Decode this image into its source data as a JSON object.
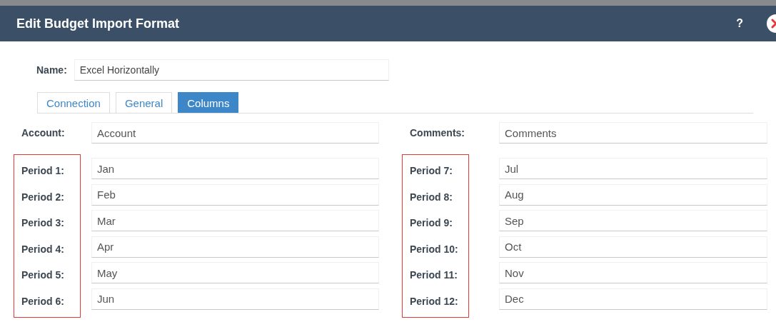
{
  "window": {
    "title": "Edit Budget Import Format",
    "help": "?"
  },
  "name_field": {
    "label": "Name:",
    "value": "Excel Horizontally"
  },
  "tabs": [
    {
      "label": "Connection",
      "selected": false
    },
    {
      "label": "General",
      "selected": false
    },
    {
      "label": "Columns",
      "selected": true
    }
  ],
  "columns": [
    {
      "header": {
        "label": "Account:",
        "value": "Account"
      },
      "periods_highlighted": true,
      "periods": [
        {
          "label": "Period 1:",
          "value": "Jan"
        },
        {
          "label": "Period 2:",
          "value": "Feb"
        },
        {
          "label": "Period 3:",
          "value": "Mar"
        },
        {
          "label": "Period 4:",
          "value": "Apr"
        },
        {
          "label": "Period 5:",
          "value": "May"
        },
        {
          "label": "Period 6:",
          "value": "Jun"
        }
      ]
    },
    {
      "header": {
        "label": "Comments:",
        "value": "Comments"
      },
      "periods_highlighted": true,
      "periods": [
        {
          "label": "Period 7:",
          "value": "Jul"
        },
        {
          "label": "Period 8:",
          "value": "Aug"
        },
        {
          "label": "Period 9:",
          "value": "Sep"
        },
        {
          "label": "Period 10:",
          "value": "Oct"
        },
        {
          "label": "Period 11:",
          "value": "Nov"
        },
        {
          "label": "Period 12:",
          "value": "Dec"
        }
      ]
    }
  ]
}
